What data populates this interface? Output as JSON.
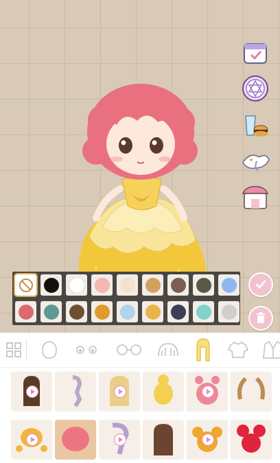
{
  "colors": {
    "accent_pink": "#f2c3cf",
    "palette_bg": "#4a4642",
    "hair_color": "#e8707f",
    "dress_color": "#f3c73a"
  },
  "side_menu": [
    {
      "icon": "calendar-icon"
    },
    {
      "icon": "magic-circle-icon"
    },
    {
      "icon": "food-icon"
    },
    {
      "icon": "pet-icon"
    },
    {
      "icon": "shop-icon"
    }
  ],
  "palette": {
    "row1": [
      {
        "color": "none",
        "icon": "no-color-icon",
        "selected": true
      },
      {
        "color": "#111111"
      },
      {
        "color": "#ffffff"
      },
      {
        "color": "#f0b7b3"
      },
      {
        "color": "#f4e2cf"
      },
      {
        "color": "#d4a061"
      },
      {
        "color": "#7a5f52"
      },
      {
        "color": "#5a5846"
      },
      {
        "color": "#8cb8ee"
      }
    ],
    "row2": [
      {
        "color": "#d96b70"
      },
      {
        "color": "#5e9a93"
      },
      {
        "color": "#6e4f36"
      },
      {
        "color": "#e29a2b"
      },
      {
        "color": "#b3d3ea"
      },
      {
        "color": "#e9b448"
      },
      {
        "color": "#3a3f54"
      },
      {
        "color": "#7fd3c8"
      },
      {
        "color": "#cfcfcf"
      }
    ]
  },
  "actions": {
    "confirm_icon": "check-icon",
    "delete_icon": "trash-icon"
  },
  "categories": [
    {
      "icon": "grid-icon"
    },
    {
      "icon": "body-icon"
    },
    {
      "icon": "eyes-icon"
    },
    {
      "icon": "glasses-icon"
    },
    {
      "icon": "back-hair-icon"
    },
    {
      "icon": "hair-icon",
      "selected": true
    },
    {
      "icon": "shirt-icon"
    },
    {
      "icon": "jacket-icon"
    }
  ],
  "hair_items": [
    {
      "name": "long-straight-hair",
      "locked_video": true
    },
    {
      "name": "side-braid-hair",
      "locked_video": false
    },
    {
      "name": "blonde-long-hair",
      "locked_video": true
    },
    {
      "name": "bun-hair",
      "locked_video": false
    },
    {
      "name": "pink-pigtail-buns",
      "locked_video": true
    },
    {
      "name": "twin-tails-hair",
      "locked_video": false
    },
    {
      "name": "curly-pigtails-hair",
      "locked_video": true
    },
    {
      "name": "pink-short-curly-hair",
      "locked_video": false,
      "selected": true
    },
    {
      "name": "purple-braid-hair",
      "locked_video": true
    },
    {
      "name": "brown-long-hair",
      "locked_video": false
    },
    {
      "name": "double-bun-hair",
      "locked_video": true
    },
    {
      "name": "red-double-bun-hair",
      "locked_video": false
    }
  ]
}
